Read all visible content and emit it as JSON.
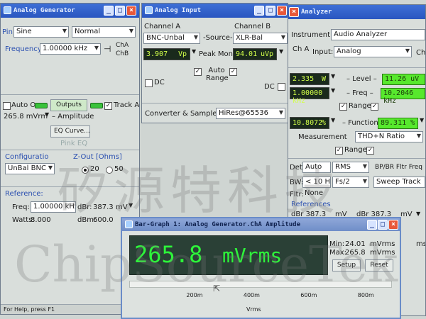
{
  "generator": {
    "title": "Analog Generator",
    "pin_label": "Pin:",
    "waveform": "Sine",
    "mode": "Normal",
    "frequency_label": "Frequency:",
    "frequency_value": "1.00000 kHz",
    "cha": "ChA",
    "chb": "ChB",
    "auto_on": "Auto On",
    "outputs": "Outputs",
    "track_a": "Track A",
    "amplitude_value": "265.8  mVrm",
    "amplitude_label": "– Amplitude",
    "eq_curve": "EQ Curve...",
    "pink_eq": "Pink EQ",
    "configuration_label": "Configuratio",
    "configuration_value": "UnBal BNC",
    "zout_label": "Z-Out [Ohms]",
    "zout_20": "20",
    "zout_50": "50",
    "reference_label": "Reference:",
    "freq_label": "Freq:",
    "freq_ref": "1.00000 kHz",
    "dbr_label": "dBr:",
    "dbr_ref": "387.3",
    "dbr_unit": "mV",
    "watts_label": "Watts:",
    "watts_ref": "8.000",
    "dbm_label": "dBm:",
    "dbm_ref": "600.0",
    "status": "For Help, press F1"
  },
  "input": {
    "title": "Analog Input",
    "channel_a": "Channel A",
    "channel_b": "Channel B",
    "source_a": "BNC-Unbal",
    "source_label": "-Source-",
    "source_b": "XLR-Bal",
    "peak_a_value": "3.907",
    "peak_a_unit": "Vp",
    "peak_label": "Peak Mon",
    "peak_b_value": "94.01",
    "peak_b_unit": "uVp",
    "auto_range": "Auto Range",
    "dc_a": "DC",
    "dc_b": "DC",
    "converter_label": "Converter & Sample",
    "converter_value": "HiRes@65536"
  },
  "analyzer": {
    "title": "Analyzer",
    "instrument_label": "Instrument",
    "instrument_value": "Audio Analyzer",
    "cha_label": "Ch A",
    "input_label": "Input:",
    "input_value": "Analog",
    "chb_label": "Ch",
    "level_a_value": "2.335",
    "level_a_unit": "W",
    "level_label": "– Level –",
    "level_b_value": "11.26",
    "level_b_unit": "uV",
    "freq_a_value": "1.00000 kHz",
    "freq_label": "– Freq –",
    "freq_b_value": "10.2046 kHz",
    "range_label": "Range",
    "func_a_value": "10.8072",
    "func_a_unit": "%",
    "function_label": "– Function",
    "func_b_value": "89.311",
    "func_b_unit": "%",
    "measurement_label": "Measurement",
    "measurement_value": "THD+N Ratio",
    "range2_label": "Range",
    "det_label": "Det:",
    "det_value": "Auto",
    "rms_value": "RMS",
    "bpbr_label": "BP/BR Fltr Freq",
    "bw_label": "BW:",
    "bw_value": "< 10 Hz",
    "fs2_value": "Fs/2",
    "sweep_value": "Sweep Track",
    "fltr_label": "Fltr:",
    "fltr_value": "None",
    "references_label": "References",
    "dbr_a": "dBr 387.3",
    "dbr_a_unit": "mV",
    "dbr_b": "dBr 387.3",
    "dbr_b_unit": "mV",
    "ms_label": "ms"
  },
  "bargraph": {
    "title": "Bar-Graph 1: Analog Generator.ChA Amplitude",
    "value": "265.8",
    "unit": "mVrms",
    "min_label": "Min:",
    "min_value": "24.01",
    "min_unit": "mVrms",
    "max_label": "Max:",
    "max_value": "265.8",
    "max_unit": "mVrms",
    "setup": "Setup",
    "reset": "Reset",
    "ticks": [
      "200m",
      "400m",
      "600m",
      "800m"
    ],
    "axis_label": "Vrms",
    "bar_fraction": 0.0
  },
  "watermark": {
    "line1": "矽源特科技",
    "line2": "ChipSourceTek"
  },
  "colors": {
    "titlebar": "#2f5fcc",
    "meter_bg": "#1a2a1c",
    "meter_text": "#d2ff4a",
    "green_meter": "#57e82d",
    "bargraph_bg": "#2a4036",
    "bargraph_text": "#2df53a"
  }
}
